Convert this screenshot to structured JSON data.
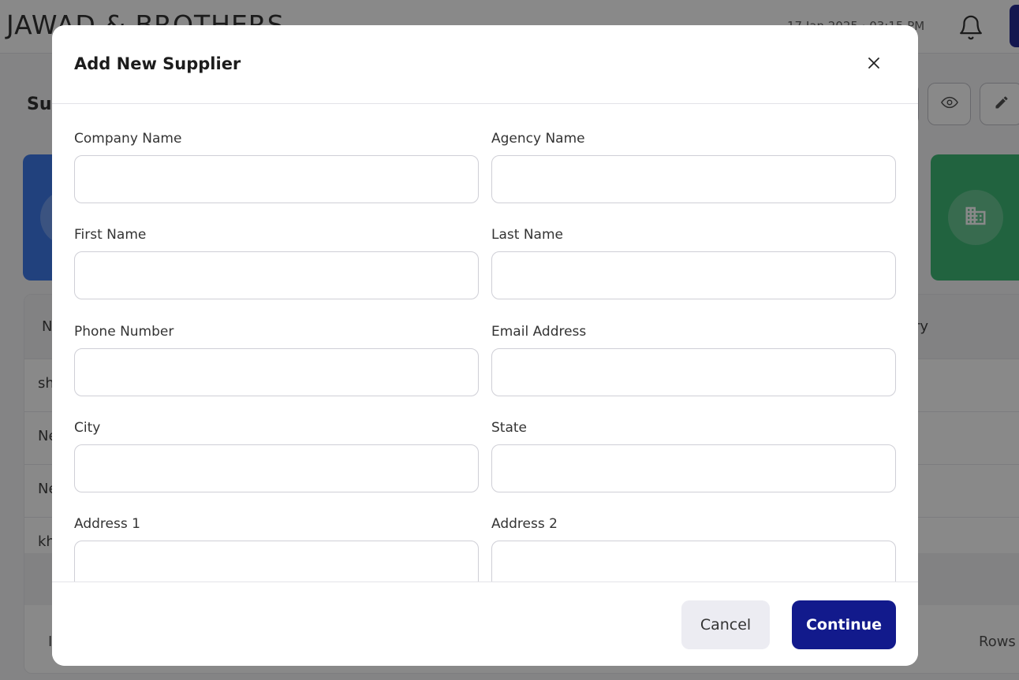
{
  "app": {
    "brand": "JAWAD & BROTHERS",
    "datetime": "17 Jan 2025 · 03:15 PM",
    "page_title": "Suppliers",
    "table": {
      "first_header": "N",
      "last_header": "ry",
      "rows": [
        "sh",
        "Ne",
        "Ne",
        "kh"
      ],
      "footer_left": "I",
      "rows_label": "Rows"
    }
  },
  "icons": {
    "bell": "bell-icon",
    "eye": "eye-icon",
    "edit": "edit-icon",
    "building": "building-icon",
    "close": "close-icon"
  },
  "colors": {
    "primary": "#121a8c",
    "card_blue": "#2f6fe6",
    "card_green": "#2fb26a"
  },
  "modal": {
    "title": "Add New Supplier",
    "fields": {
      "company_name": {
        "label": "Company Name",
        "value": ""
      },
      "agency_name": {
        "label": "Agency Name",
        "value": ""
      },
      "first_name": {
        "label": "First Name",
        "value": ""
      },
      "last_name": {
        "label": "Last Name",
        "value": ""
      },
      "phone_number": {
        "label": "Phone Number",
        "value": ""
      },
      "email_address": {
        "label": "Email Address",
        "value": ""
      },
      "city": {
        "label": "City",
        "value": ""
      },
      "state": {
        "label": "State",
        "value": ""
      },
      "address_1": {
        "label": "Address 1",
        "value": ""
      },
      "address_2": {
        "label": "Address 2",
        "value": ""
      }
    },
    "cancel_label": "Cancel",
    "continue_label": "Continue"
  }
}
